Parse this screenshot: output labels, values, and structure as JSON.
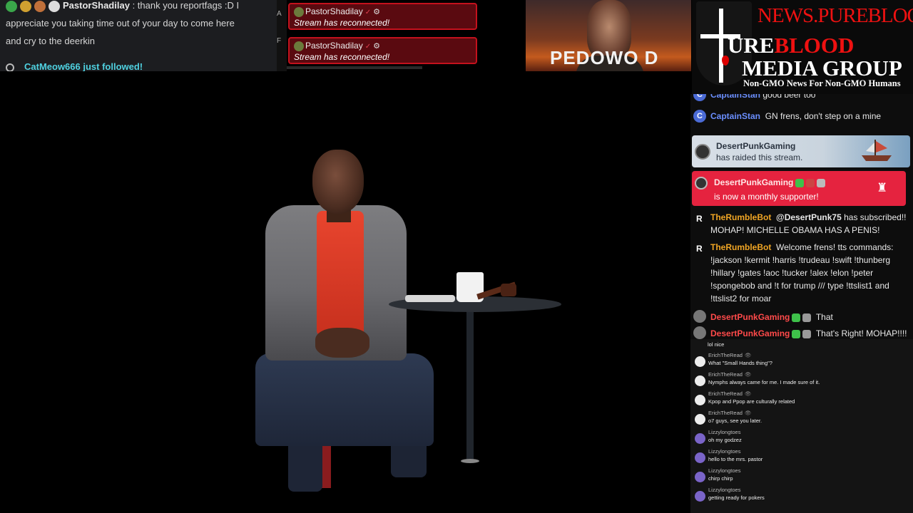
{
  "top_left_chat": {
    "username": "PastorShadilay",
    "message_line1": ":  thank you reportfags :D I",
    "message_line2": "appreciate you taking time out of your day to come here",
    "message_line3": "and cry to the deerkin",
    "follow_text": "CatMeow666 just followed!",
    "side_letters": [
      "A",
      "F"
    ]
  },
  "alerts": [
    {
      "user": "PastorShadilay",
      "text": "Stream has reconnected!"
    },
    {
      "user": "PastorShadilay",
      "text": "Stream has reconnected!"
    }
  ],
  "thumbnail": {
    "caption": "PEDOWO D"
  },
  "brand": {
    "url": "NEWS.PUREBLOOD.MEDIA",
    "line1_white": "URE",
    "line1_red": "BLOOD",
    "line2": "MEDIA GROUP",
    "tagline": "Non-GMO News For Non-GMO Humans"
  },
  "chat": {
    "partial_user": "CaptainStan",
    "partial_text": "good beer too",
    "captain_user": "CaptainStan",
    "captain_text": "GN frens, don't step on a mine",
    "raid_user": "DesertPunkGaming",
    "raid_text": "has raided this stream.",
    "sub_user": "DesertPunkGaming",
    "sub_text": "is now a monthly supporter!",
    "bot1_user": "TheRumbleBot",
    "bot1_mention": "@DesertPunk75",
    "bot1_text1": " has subscribed!!",
    "bot1_text2": "MOHAP! MICHELLE OBAMA HAS A PENIS!",
    "bot2_user": "TheRumbleBot",
    "bot2_lines": [
      "Welcome frens! tts commands:",
      "!jackson !kermit !harris !trudeau !swift !thunberg",
      "!hillary !gates !aoc !tucker !alex !elon !peter",
      "!spongebob and !t for trump /// type !ttslist1 and",
      "!ttslist2 for moar"
    ],
    "dpg1_user": "DesertPunkGaming",
    "dpg1_text": "That",
    "dpg2_user": "DesertPunkGaming",
    "dpg2_text": "That's Right! MOHAP!!!!"
  },
  "lower_chat": {
    "partial_text": "lol nice",
    "messages": [
      {
        "user": "ErichTheRead",
        "text": "What \"Small Hands thing\"?"
      },
      {
        "user": "ErichTheRead",
        "text": "Nymphs always came for me. I made sure of it."
      },
      {
        "user": "ErichTheRead",
        "text": "Kpop and Ppop are culturally related"
      },
      {
        "user": "ErichTheRead",
        "text": "o7 guys, see you later."
      },
      {
        "user": "Lizzylongtoes",
        "text": "oh my godzez"
      },
      {
        "user": "Lizzylongtoes",
        "text": "hello to the mrs. pastor"
      },
      {
        "user": "Lizzylongtoes",
        "text": "chirp chirp"
      },
      {
        "user": "Lizzylongtoes",
        "text": "getting ready for pokers"
      }
    ]
  },
  "colors": {
    "alert_bg": "#5a0a10",
    "alert_border": "#c4111d",
    "sub_card": "#e5233f",
    "brand_red": "#ee1111",
    "username_blue": "#6b8fff",
    "username_orange": "#f0a524",
    "username_red": "#ff4a4a",
    "follow_cyan": "#4fd1e0"
  },
  "icons": [
    "gear-icon",
    "verified-check-icon",
    "rook-icon",
    "eye-icon",
    "follow-person-icon",
    "rumble-r-icon"
  ]
}
